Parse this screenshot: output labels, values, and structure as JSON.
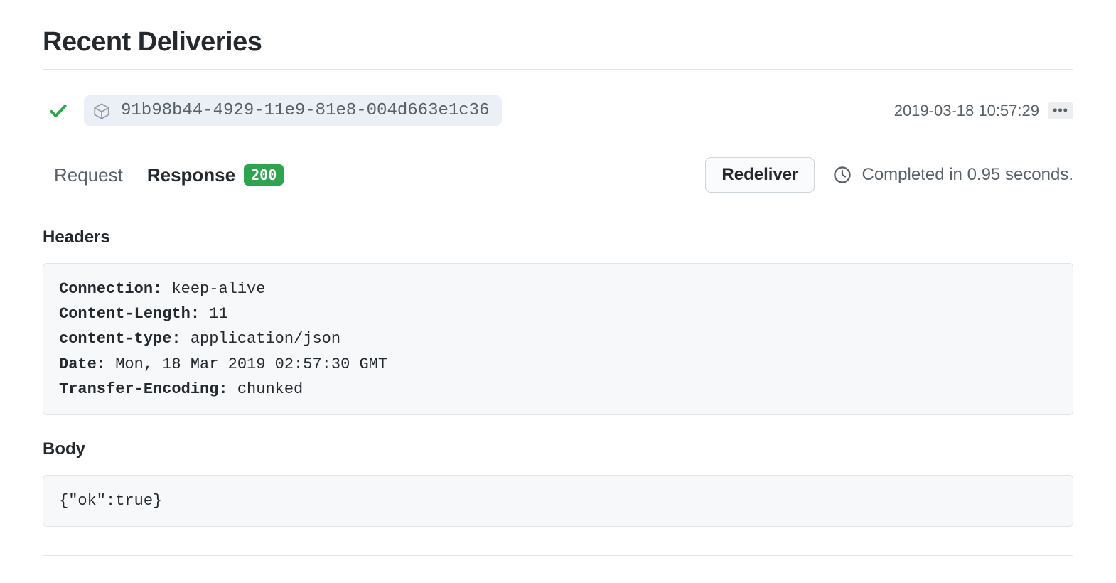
{
  "page_title": "Recent Deliveries",
  "delivery": {
    "id": "91b98b44-4929-11e9-81e8-004d663e1c36",
    "timestamp": "2019-03-18 10:57:29",
    "status": "success"
  },
  "tabs": {
    "request_label": "Request",
    "response_label": "Response",
    "status_code": "200",
    "active": "response"
  },
  "actions": {
    "redeliver_label": "Redeliver"
  },
  "completed_text": "Completed in 0.95 seconds.",
  "sections": {
    "headers_title": "Headers",
    "body_title": "Body"
  },
  "response_headers": [
    {
      "key": "Connection",
      "value": "keep-alive"
    },
    {
      "key": "Content-Length",
      "value": "11"
    },
    {
      "key": "content-type",
      "value": "application/json"
    },
    {
      "key": "Date",
      "value": "Mon, 18 Mar 2019 02:57:30 GMT"
    },
    {
      "key": "Transfer-Encoding",
      "value": "chunked"
    }
  ],
  "response_body": "{\"ok\":true}"
}
